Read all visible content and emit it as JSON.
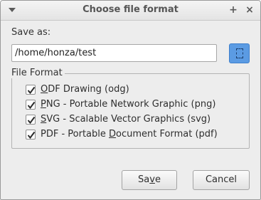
{
  "window": {
    "title": "Choose file format",
    "maximize_glyph": "+",
    "close_glyph": "×"
  },
  "save_as": {
    "label": "Save as:",
    "path_value": "/home/honza/test"
  },
  "file_format": {
    "legend": "File Format",
    "options": [
      {
        "mnemonic": "O",
        "rest": "DF Drawing (odg)",
        "checked": true
      },
      {
        "mnemonic": "P",
        "rest": "NG - Portable Network Graphic (png)",
        "checked": true
      },
      {
        "mnemonic": "S",
        "rest": "VG - Scalable Vector Graphics (svg)",
        "checked": true
      },
      {
        "pre": "PDF - Portable ",
        "mnemonic": "D",
        "rest": "ocument Format (pdf)",
        "checked": true
      }
    ]
  },
  "buttons": {
    "save": {
      "pre": "Sa",
      "mnemonic": "v",
      "rest": "e"
    },
    "cancel": "Cancel"
  },
  "colors": {
    "accent": "#5b9be3",
    "window_bg": "#ededed"
  }
}
